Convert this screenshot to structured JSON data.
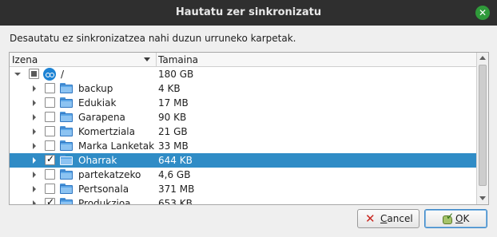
{
  "window": {
    "title": "Hautatu zer sinkronizatu",
    "close_label": "✕"
  },
  "instruction": "Desautatu ez sinkronizatzea nahi duzun urruneko karpetak.",
  "tree": {
    "columns": {
      "name": "Izena",
      "size": "Tamaina"
    },
    "root": {
      "name": "/",
      "size": "180 GB",
      "check_state": "partial",
      "icon": "nextcloud-cloud-icon"
    },
    "rows": [
      {
        "name": "backup",
        "size": "4 KB",
        "checked": false,
        "selected": false
      },
      {
        "name": "Edukiak",
        "size": "17 MB",
        "checked": false,
        "selected": false
      },
      {
        "name": "Garapena",
        "size": "90 KB",
        "checked": false,
        "selected": false
      },
      {
        "name": "Komertziala",
        "size": "21 GB",
        "checked": false,
        "selected": false
      },
      {
        "name": "Marka Lanketak",
        "size": "33 MB",
        "checked": false,
        "selected": false
      },
      {
        "name": "Oharrak",
        "size": "644 KB",
        "checked": true,
        "selected": true
      },
      {
        "name": "partekatzeko",
        "size": "4,6 GB",
        "checked": false,
        "selected": false
      },
      {
        "name": "Pertsonala",
        "size": "371 MB",
        "checked": false,
        "selected": false
      },
      {
        "name": "Produkzioa",
        "size": "653 KB",
        "checked": true,
        "selected": false
      }
    ],
    "colors": {
      "selection": "#308cc6"
    }
  },
  "buttons": {
    "cancel_first": "C",
    "cancel_rest": "ancel",
    "ok_first": "O",
    "ok_rest": "K"
  }
}
